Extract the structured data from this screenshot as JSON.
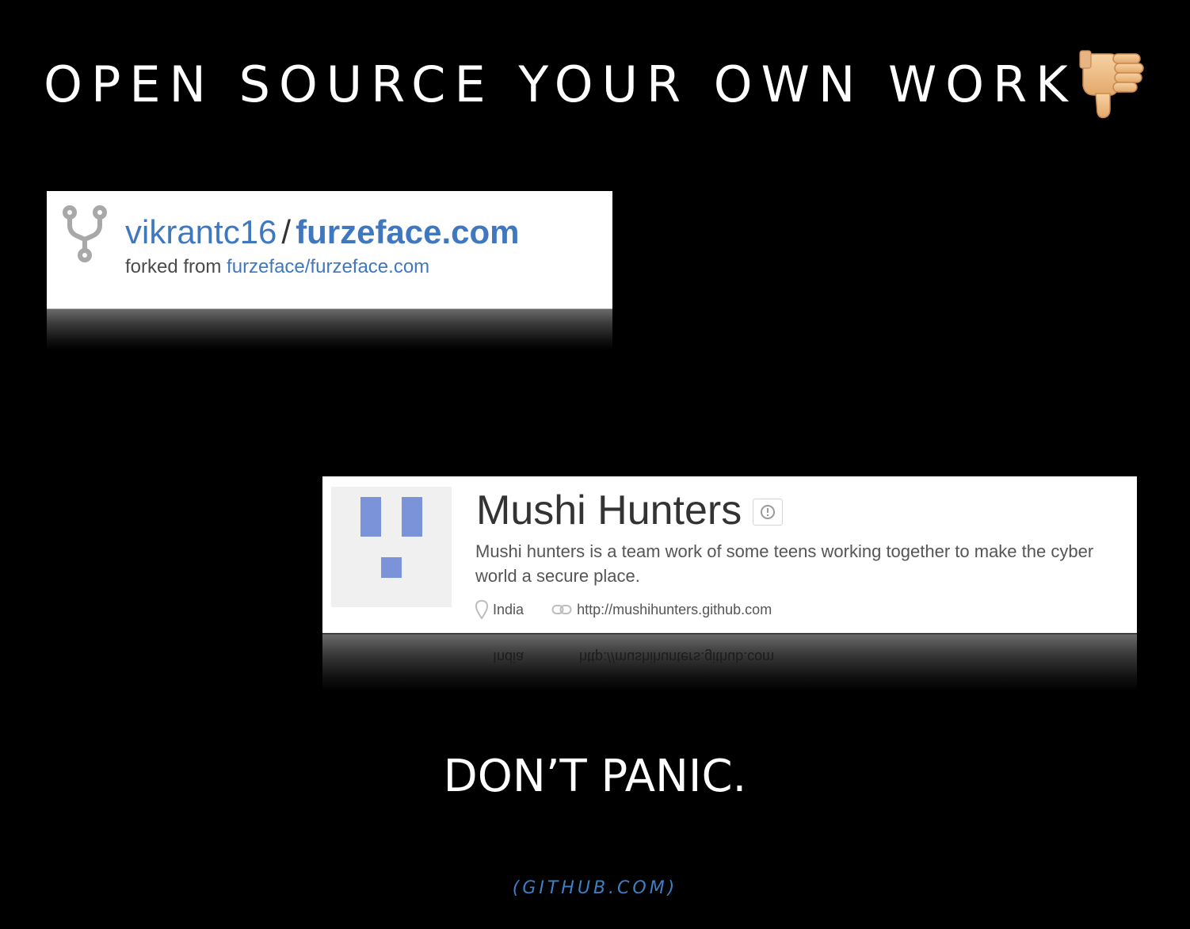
{
  "slide": {
    "title": "OPEN SOURCE YOUR OWN WORK",
    "title_emoji": "thumbs-down",
    "tagline": "DON’T PANIC.",
    "credit": "(GITHUB.COM)"
  },
  "fork_card": {
    "owner": "vikrantc16",
    "separator": "/",
    "repo": "furzeface.com",
    "forked_prefix": "forked from",
    "forked_source": "furzeface/furzeface.com",
    "icon": "repo-forked-icon"
  },
  "org_card": {
    "name": "Mushi Hunters",
    "badge_icon": "info-badge-icon",
    "description": "Mushi hunters is a team work of some teens working together to make the cyber world a secure place.",
    "location": "India",
    "location_icon": "location-pin-icon",
    "website": "http://mushihunters.github.com",
    "website_icon": "link-icon",
    "avatar_color": "#7b93d8"
  },
  "colors": {
    "background": "#000000",
    "link_blue": "#4078c0",
    "credit_blue": "#3f7fc4"
  }
}
